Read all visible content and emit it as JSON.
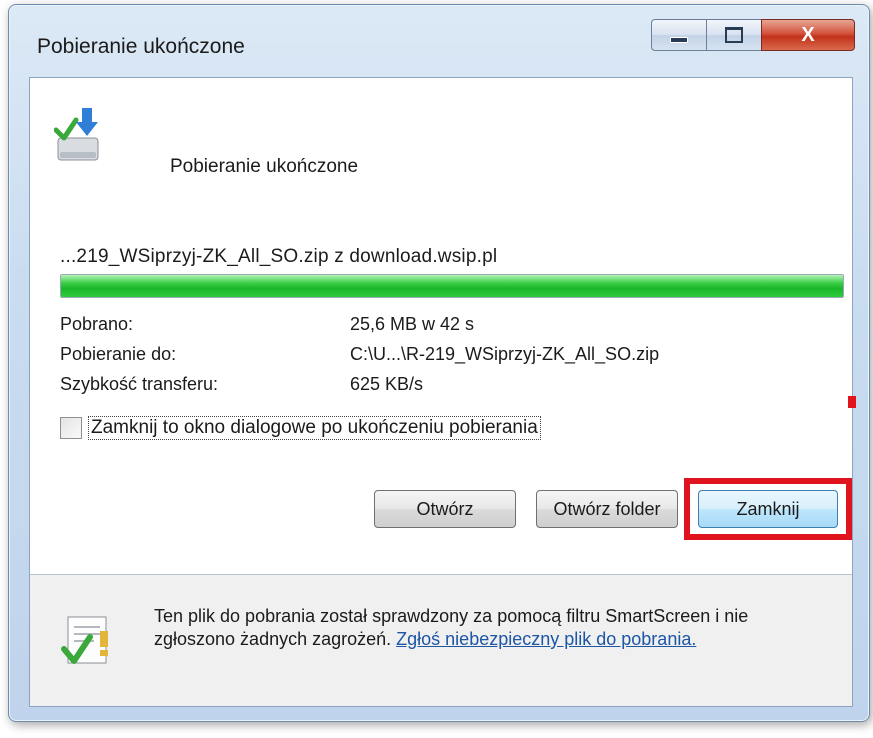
{
  "window": {
    "title": "Pobieranie ukończone",
    "controls": {
      "minimize": "minimize-icon",
      "maximize": "maximize-icon",
      "close": "close-icon",
      "close_glyph": "X"
    }
  },
  "header": {
    "text": "Pobieranie ukończone",
    "icon": "download-complete-icon"
  },
  "download": {
    "filename": "...219_WSiprzyj-ZK_All_SO.zip z download.wsip.pl",
    "progress_percent": 100,
    "progress_color": "#19b62a"
  },
  "info": {
    "downloaded_label": "Pobrano:",
    "downloaded_value": "25,6 MB w 42 s",
    "destination_label": "Pobieranie do:",
    "destination_value": "C:\\U...\\R-219_WSiprzyj-ZK_All_SO.zip",
    "speed_label": "Szybkość transferu:",
    "speed_value": "625 KB/s"
  },
  "checkbox": {
    "label": "Zamknij to okno dialogowe po ukończeniu pobierania",
    "checked": false
  },
  "buttons": {
    "open": "Otwórz",
    "open_folder": "Otwórz folder",
    "close": "Zamknij"
  },
  "highlight_color": "#e0141e",
  "footer": {
    "icon": "smartscreen-shield-icon",
    "text": "Ten plik do pobrania został sprawdzony za pomocą filtru SmartScreen i nie zgłoszono żadnych zagrożeń. ",
    "link": "Zgłoś niebezpieczny plik do pobrania."
  }
}
